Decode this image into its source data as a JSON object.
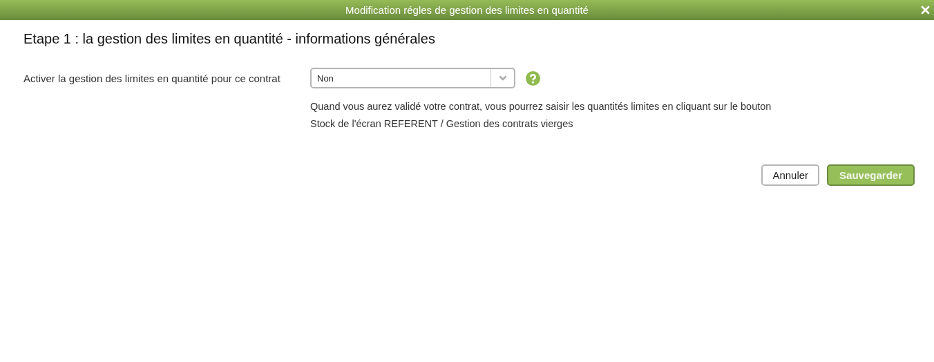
{
  "window": {
    "title": "Modification régles de gestion des limites en quantité"
  },
  "heading": "Etape 1 : la gestion des limites en quantité - informations générales",
  "field": {
    "label": "Activer la gestion des limites en quantité pour ce contrat",
    "value": "Non",
    "help": "Quand vous aurez validé votre contrat, vous pourrez saisir les quantités limites en cliquant sur le bouton Stock de l'écran REFERENT / Gestion des contrats vierges"
  },
  "buttons": [
    {
      "label": "Annuler",
      "kind": "secondary"
    },
    {
      "label": "Sauvegarder",
      "kind": "primary"
    }
  ]
}
